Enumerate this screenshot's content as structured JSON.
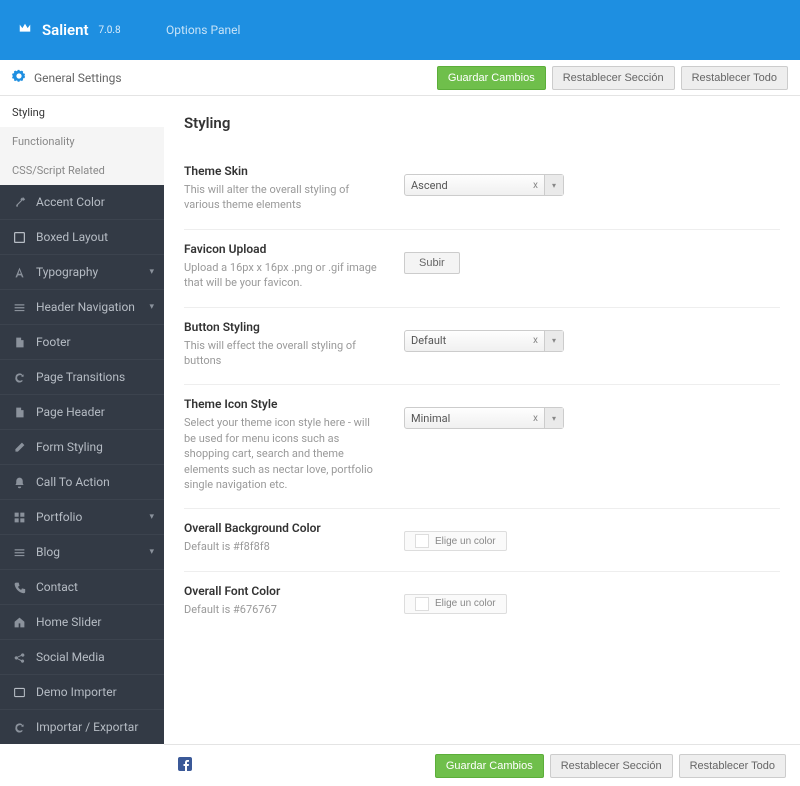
{
  "brand": {
    "name": "Salient",
    "version": "7.0.8",
    "subtitle": "Options Panel"
  },
  "header": {
    "section": "General Settings"
  },
  "buttons": {
    "save": "Guardar Cambios",
    "resetSection": "Restablecer Sección",
    "resetAll": "Restablecer Todo"
  },
  "subtabs": [
    "Styling",
    "Functionality",
    "CSS/Script Related"
  ],
  "nav": [
    {
      "label": "Accent Color",
      "icon": "eyedropper",
      "expand": false
    },
    {
      "label": "Boxed Layout",
      "icon": "square",
      "expand": false
    },
    {
      "label": "Typography",
      "icon": "font",
      "expand": true
    },
    {
      "label": "Header Navigation",
      "icon": "menu",
      "expand": true
    },
    {
      "label": "Footer",
      "icon": "doc",
      "expand": false
    },
    {
      "label": "Page Transitions",
      "icon": "refresh",
      "expand": false
    },
    {
      "label": "Page Header",
      "icon": "doc",
      "expand": false
    },
    {
      "label": "Form Styling",
      "icon": "edit",
      "expand": false
    },
    {
      "label": "Call To Action",
      "icon": "bell",
      "expand": false
    },
    {
      "label": "Portfolio",
      "icon": "grid",
      "expand": true
    },
    {
      "label": "Blog",
      "icon": "menu",
      "expand": true
    },
    {
      "label": "Contact",
      "icon": "phone",
      "expand": false
    },
    {
      "label": "Home Slider",
      "icon": "home",
      "expand": false
    },
    {
      "label": "Social Media",
      "icon": "share",
      "expand": false
    },
    {
      "label": "Demo Importer",
      "icon": "window",
      "expand": false
    },
    {
      "label": "Importar / Exportar",
      "icon": "refresh",
      "expand": false
    }
  ],
  "pageTitle": "Styling",
  "fields": {
    "themeSkin": {
      "title": "Theme Skin",
      "desc": "This will alter the overall styling of various theme elements",
      "value": "Ascend"
    },
    "favicon": {
      "title": "Favicon Upload",
      "desc": "Upload a 16px x 16px .png or .gif image that will be your favicon.",
      "btn": "Subir"
    },
    "buttonStyle": {
      "title": "Button Styling",
      "desc": "This will effect the overall styling of buttons",
      "value": "Default"
    },
    "iconStyle": {
      "title": "Theme Icon Style",
      "desc": "Select your theme icon style here - will be used for menu icons such as shopping cart, search and theme elements such as nectar love, portfolio single navigation etc.",
      "value": "Minimal"
    },
    "bgColor": {
      "title": "Overall Background Color",
      "desc": "Default is #f8f8f8",
      "btn": "Elige un color"
    },
    "fontColor": {
      "title": "Overall Font Color",
      "desc": "Default is #676767",
      "btn": "Elige un color"
    }
  }
}
